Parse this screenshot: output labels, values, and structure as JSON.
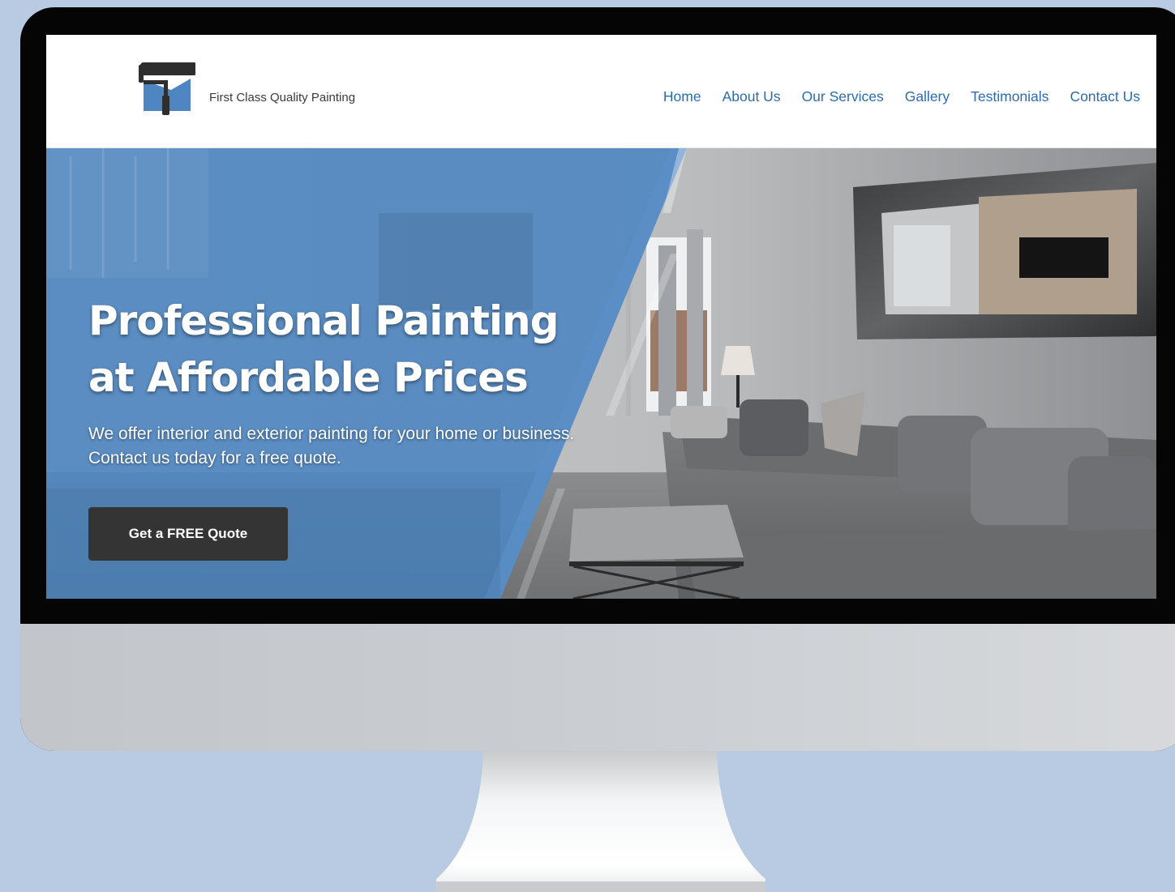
{
  "site": {
    "brand_name": "First Class Quality Painting",
    "logo_icon": "paint-roller-icon"
  },
  "nav": {
    "items": [
      {
        "label": "Home"
      },
      {
        "label": "About Us"
      },
      {
        "label": "Our Services"
      },
      {
        "label": "Gallery"
      },
      {
        "label": "Testimonials"
      },
      {
        "label": "Contact Us"
      }
    ]
  },
  "hero": {
    "title_line1": "Professional Painting",
    "title_line2": "at Affordable Prices",
    "subtitle": "We offer interior and exterior painting for your home or business. Contact us today for a free quote.",
    "cta_label": "Get a FREE Quote"
  },
  "colors": {
    "page_background": "#b9cae3",
    "overlay_blue": "#4f86c1",
    "nav_link": "#2c6cae",
    "cta_background": "#343434"
  }
}
